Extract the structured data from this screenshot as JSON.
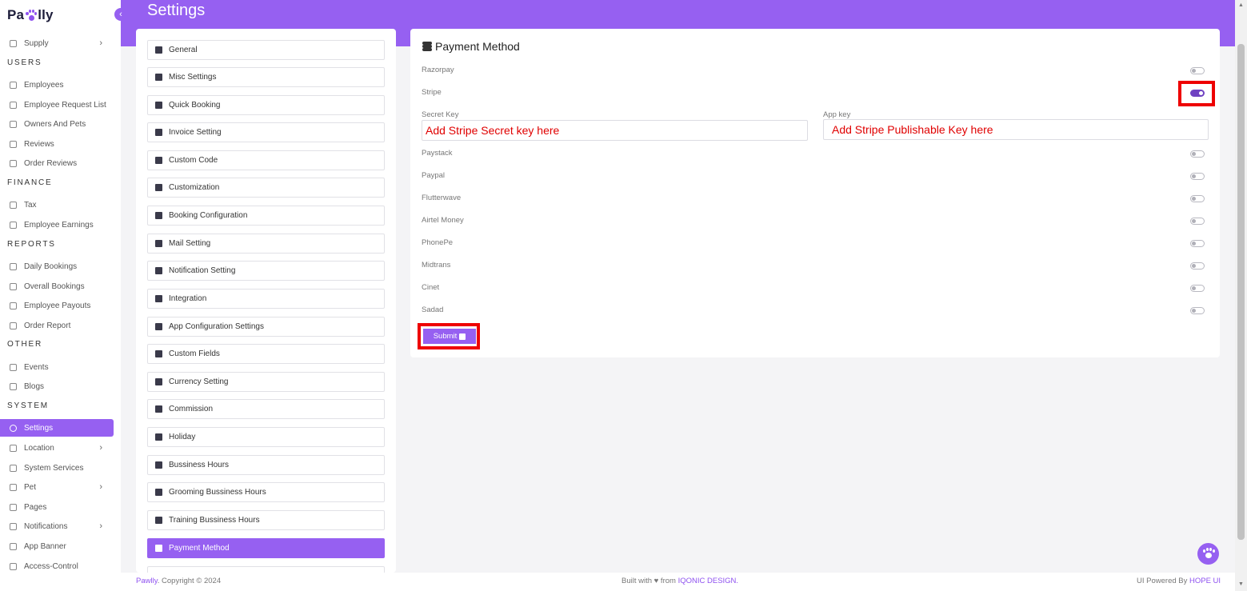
{
  "app": {
    "brand_prefix": "Pa",
    "brand_suffix": "lly"
  },
  "sidebar": {
    "items": [
      {
        "label": "Supply",
        "icon": "truck-icon",
        "chevron": "›"
      },
      {
        "section": "USERS"
      },
      {
        "label": "Employees",
        "icon": "calendar-icon"
      },
      {
        "label": "Employee Request List",
        "icon": "calendar-icon"
      },
      {
        "label": "Owners And Pets",
        "icon": "paw-icon"
      },
      {
        "label": "Reviews",
        "icon": "star-icon"
      },
      {
        "label": "Order Reviews",
        "icon": "star-icon"
      },
      {
        "section": "FINANCE"
      },
      {
        "label": "Tax",
        "icon": "circle-icon"
      },
      {
        "label": "Employee Earnings",
        "icon": "wallet-icon"
      },
      {
        "section": "REPORTS"
      },
      {
        "label": "Daily Bookings",
        "icon": "calendar-icon"
      },
      {
        "label": "Overall Bookings",
        "icon": "calendar-icon"
      },
      {
        "label": "Employee Payouts",
        "icon": "scan-icon"
      },
      {
        "label": "Order Report",
        "icon": "chart-icon"
      },
      {
        "section": "OTHER"
      },
      {
        "label": "Events",
        "icon": "calendar-icon"
      },
      {
        "label": "Blogs",
        "icon": "calendar-icon"
      },
      {
        "section": "SYSTEM"
      },
      {
        "label": "Settings",
        "icon": "gear-icon",
        "active": true
      },
      {
        "label": "Location",
        "icon": "location-pin-icon",
        "chevron": "›"
      },
      {
        "label": "System Services",
        "icon": "user-icon"
      },
      {
        "label": "Pet",
        "icon": "paw-icon",
        "chevron": "›"
      },
      {
        "label": "Pages",
        "icon": "page-icon"
      },
      {
        "label": "Notifications",
        "icon": "bell-icon",
        "chevron": "›"
      },
      {
        "label": "App Banner",
        "icon": "phone-icon"
      },
      {
        "label": "Access-Control",
        "icon": "shield-icon"
      }
    ]
  },
  "header": {
    "title": "Settings",
    "collapse_glyph": "‹"
  },
  "settings_menu": {
    "items": [
      {
        "label": "General",
        "icon": "cube-icon"
      },
      {
        "label": "Misc Settings",
        "icon": "tools-icon"
      },
      {
        "label": "Quick Booking",
        "icon": "paper-plane-icon"
      },
      {
        "label": "Invoice Setting",
        "icon": "file-icon"
      },
      {
        "label": "Custom Code",
        "icon": "file-code-icon"
      },
      {
        "label": "Customization",
        "icon": "palette-icon"
      },
      {
        "label": "Booking Configuration",
        "icon": "paper-plane-icon"
      },
      {
        "label": "Mail Setting",
        "icon": "envelope-icon"
      },
      {
        "label": "Notification Setting",
        "icon": "megaphone-icon"
      },
      {
        "label": "Integration",
        "icon": "sliders-icon"
      },
      {
        "label": "App Configuration Settings",
        "icon": "sliders-icon"
      },
      {
        "label": "Custom Fields",
        "icon": "bars-icon"
      },
      {
        "label": "Currency Setting",
        "icon": "dollar-icon"
      },
      {
        "label": "Commission",
        "icon": "percent-icon"
      },
      {
        "label": "Holiday",
        "icon": "calendar-icon"
      },
      {
        "label": "Bussiness Hours",
        "icon": "clock-icon"
      },
      {
        "label": "Grooming Bussiness Hours",
        "icon": "clock-icon"
      },
      {
        "label": "Training Bussiness Hours",
        "icon": "clock-icon"
      },
      {
        "label": "Payment Method",
        "icon": "coins-icon",
        "active": true
      }
    ]
  },
  "payment": {
    "title": "Payment Method",
    "gateways": [
      {
        "label": "Razorpay",
        "enabled": false
      },
      {
        "label": "Stripe",
        "enabled": true
      },
      {
        "label": "Paystack",
        "enabled": false
      },
      {
        "label": "Paypal",
        "enabled": false
      },
      {
        "label": "Flutterwave",
        "enabled": false
      },
      {
        "label": "Airtel Money",
        "enabled": false
      },
      {
        "label": "PhonePe",
        "enabled": false
      },
      {
        "label": "Midtrans",
        "enabled": false
      },
      {
        "label": "Cinet",
        "enabled": false
      },
      {
        "label": "Sadad",
        "enabled": false
      }
    ],
    "secret_key_label": "Secret Key",
    "secret_key_placeholder": "Add Stripe Secret key here",
    "app_key_label": "App key",
    "app_key_placeholder": "Add Stripe Publishable Key here",
    "submit_label": "Submit",
    "highlight_color": "#ee0000"
  },
  "footer": {
    "brand": "Pawlly",
    "copyright": ". Copyright © 2024",
    "built_with": "Built with ♥ from ",
    "built_by": "IQONIC DESIGN.",
    "powered_by": "UI Powered By ",
    "powered_name": "HOPE UI"
  },
  "colors": {
    "accent": "#9660f1",
    "toggle_on": "#6f42c1"
  }
}
